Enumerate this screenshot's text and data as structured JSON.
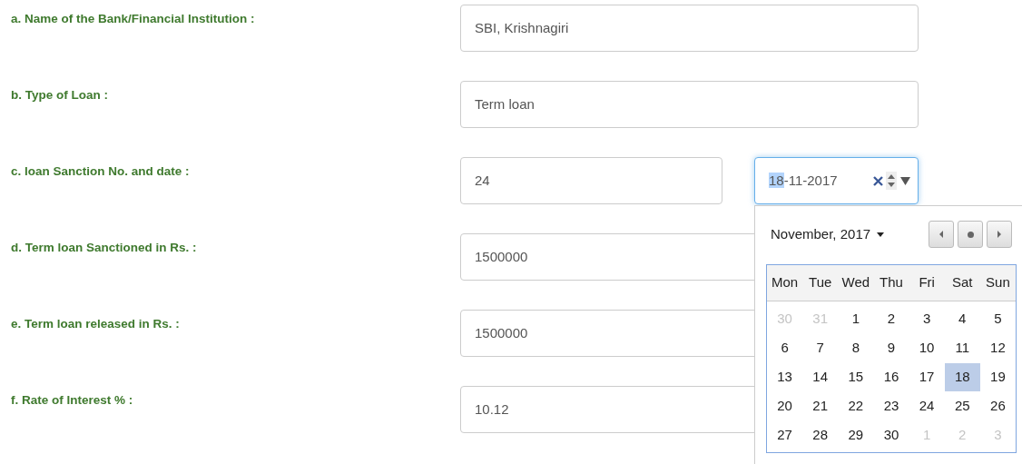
{
  "rows": [
    {
      "label": "a. Name of the Bank/Financial Institution :",
      "value": "SBI, Krishnagiri"
    },
    {
      "label": "b. Type of Loan :",
      "value": "Term loan"
    },
    {
      "label": "c. loan Sanction No. and date :",
      "value": "24",
      "date_field": {
        "highlighted": "18",
        "rest": "-11-2017",
        "focused": true
      }
    },
    {
      "label": "d. Term loan Sanctioned in Rs. :",
      "value": "1500000"
    },
    {
      "label": "e. Term loan released in Rs. :",
      "value": "1500000"
    },
    {
      "label": "f. Rate of Interest % :",
      "value": "10.12"
    }
  ],
  "calendar": {
    "month": "November, 2017",
    "weekdays": [
      "Mon",
      "Tue",
      "Wed",
      "Thu",
      "Fri",
      "Sat",
      "Sun"
    ],
    "weeks": [
      [
        {
          "day": "30",
          "outside": true,
          "selected": false
        },
        {
          "day": "31",
          "outside": true,
          "selected": false
        },
        {
          "day": "1",
          "outside": false,
          "selected": false
        },
        {
          "day": "2",
          "outside": false,
          "selected": false
        },
        {
          "day": "3",
          "outside": false,
          "selected": false
        },
        {
          "day": "4",
          "outside": false,
          "selected": false
        },
        {
          "day": "5",
          "outside": false,
          "selected": false
        }
      ],
      [
        {
          "day": "6",
          "outside": false,
          "selected": false
        },
        {
          "day": "7",
          "outside": false,
          "selected": false
        },
        {
          "day": "8",
          "outside": false,
          "selected": false
        },
        {
          "day": "9",
          "outside": false,
          "selected": false
        },
        {
          "day": "10",
          "outside": false,
          "selected": false
        },
        {
          "day": "11",
          "outside": false,
          "selected": false
        },
        {
          "day": "12",
          "outside": false,
          "selected": false
        }
      ],
      [
        {
          "day": "13",
          "outside": false,
          "selected": false
        },
        {
          "day": "14",
          "outside": false,
          "selected": false
        },
        {
          "day": "15",
          "outside": false,
          "selected": false
        },
        {
          "day": "16",
          "outside": false,
          "selected": false
        },
        {
          "day": "17",
          "outside": false,
          "selected": false
        },
        {
          "day": "18",
          "outside": false,
          "selected": true
        },
        {
          "day": "19",
          "outside": false,
          "selected": false
        }
      ],
      [
        {
          "day": "20",
          "outside": false,
          "selected": false
        },
        {
          "day": "21",
          "outside": false,
          "selected": false
        },
        {
          "day": "22",
          "outside": false,
          "selected": false
        },
        {
          "day": "23",
          "outside": false,
          "selected": false
        },
        {
          "day": "24",
          "outside": false,
          "selected": false
        },
        {
          "day": "25",
          "outside": false,
          "selected": false
        },
        {
          "day": "26",
          "outside": false,
          "selected": false
        }
      ],
      [
        {
          "day": "27",
          "outside": false,
          "selected": false
        },
        {
          "day": "28",
          "outside": false,
          "selected": false
        },
        {
          "day": "29",
          "outside": false,
          "selected": false
        },
        {
          "day": "30",
          "outside": false,
          "selected": false
        },
        {
          "day": "1",
          "outside": true,
          "selected": false
        },
        {
          "day": "2",
          "outside": true,
          "selected": false
        },
        {
          "day": "3",
          "outside": true,
          "selected": false
        }
      ]
    ]
  }
}
